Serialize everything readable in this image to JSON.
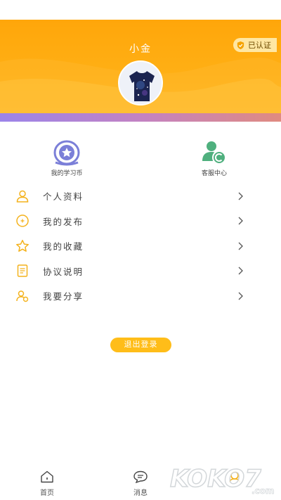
{
  "profile": {
    "username": "小金",
    "verified_label": "已认证"
  },
  "shortcuts": [
    {
      "label": "我的学习币",
      "icon": "star-badge-icon"
    },
    {
      "label": "客服中心",
      "icon": "customer-service-icon"
    }
  ],
  "menu": {
    "items": [
      {
        "label": "个人资料",
        "icon": "person-icon"
      },
      {
        "label": "我的发布",
        "icon": "plus-circle-icon"
      },
      {
        "label": "我的收藏",
        "icon": "star-icon"
      },
      {
        "label": "协议说明",
        "icon": "document-icon"
      },
      {
        "label": "我要分享",
        "icon": "share-people-icon"
      }
    ]
  },
  "logout_label": "退出登录",
  "tabbar": {
    "items": [
      {
        "label": "首页",
        "icon": "home-icon"
      },
      {
        "label": "消息",
        "icon": "message-icon"
      },
      {
        "label": "",
        "icon": "mine-icon"
      }
    ]
  },
  "watermark_text": "KOKO7.com",
  "colors": {
    "header": "#ffab0f",
    "accent": "#ffbd19",
    "icon": "#f4b21c",
    "band_start": "#9b84ea",
    "band_end": "#e08b80",
    "service_green": "#4fb07e",
    "coin_purple": "#7b7fd8"
  }
}
